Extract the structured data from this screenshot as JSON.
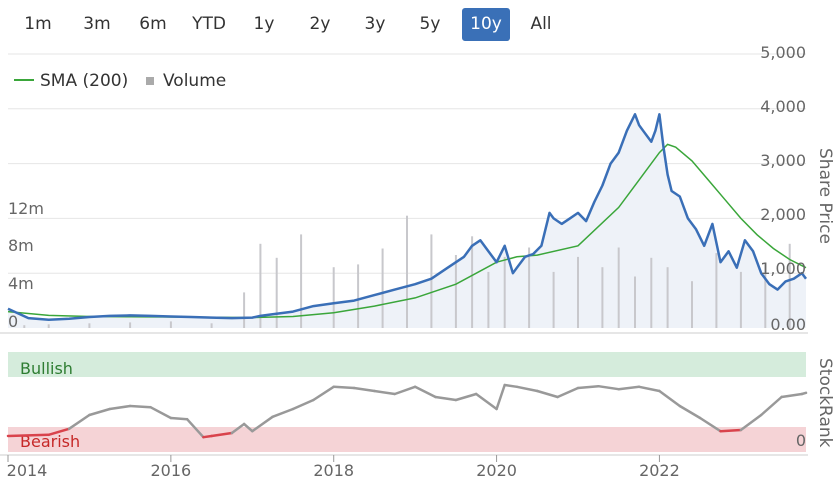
{
  "range_selector": {
    "buttons": [
      "1m",
      "3m",
      "6m",
      "YTD",
      "1y",
      "2y",
      "3y",
      "5y",
      "10y",
      "All"
    ],
    "active": "10y"
  },
  "colors": {
    "price": "#3a6fb7",
    "sma": "#3aa63a",
    "volume": "#c8c8cc",
    "rank_line": "#999999",
    "rank_bearish_line": "#d9434c",
    "bullish_band": "#d5ecdc",
    "bearish_band": "#f5d3d6",
    "active_button": "#3a70b7"
  },
  "chart_data": [
    {
      "type": "line",
      "legend": [
        {
          "name": "SMA (200)",
          "marker": "line"
        },
        {
          "name": "Volume",
          "marker": "square"
        }
      ],
      "ylabel": "Share Price",
      "price_ticks": [
        "5,000",
        "4,000",
        "3,000",
        "2,000",
        "1,000",
        "0.00"
      ],
      "price_ylim": [
        0,
        5000
      ],
      "volume_ticks": [
        "12m",
        "8m",
        "4m",
        "0"
      ],
      "volume_ylim": [
        0,
        14000000
      ],
      "x_ticks": [
        "2014",
        "2016",
        "2018",
        "2020",
        "2022"
      ],
      "xlim": [
        2014.0,
        2023.8
      ],
      "series": [
        {
          "name": "Price",
          "x": [
            2014.0,
            2014.25,
            2014.5,
            2014.75,
            2015.0,
            2015.25,
            2015.5,
            2015.75,
            2016.0,
            2016.25,
            2016.5,
            2016.75,
            2017.0,
            2017.1,
            2017.25,
            2017.5,
            2017.75,
            2018.0,
            2018.25,
            2018.5,
            2018.75,
            2019.0,
            2019.2,
            2019.4,
            2019.6,
            2019.7,
            2019.8,
            2019.9,
            2020.0,
            2020.1,
            2020.2,
            2020.25,
            2020.35,
            2020.45,
            2020.55,
            2020.65,
            2020.7,
            2020.8,
            2020.9,
            2021.0,
            2021.1,
            2021.2,
            2021.3,
            2021.4,
            2021.5,
            2021.6,
            2021.7,
            2021.75,
            2021.8,
            2021.9,
            2021.95,
            2022.0,
            2022.05,
            2022.1,
            2022.15,
            2022.25,
            2022.35,
            2022.45,
            2022.55,
            2022.65,
            2022.75,
            2022.85,
            2022.95,
            2023.05,
            2023.15,
            2023.25,
            2023.35,
            2023.45,
            2023.55,
            2023.65,
            2023.75,
            2023.8
          ],
          "y": [
            350,
            180,
            150,
            170,
            200,
            220,
            230,
            220,
            210,
            200,
            190,
            180,
            190,
            220,
            250,
            300,
            400,
            450,
            500,
            600,
            700,
            800,
            900,
            1100,
            1300,
            1500,
            1600,
            1400,
            1200,
            1500,
            1000,
            1100,
            1300,
            1350,
            1500,
            2100,
            2000,
            1900,
            2000,
            2100,
            1950,
            2300,
            2600,
            3000,
            3200,
            3600,
            3900,
            3700,
            3600,
            3400,
            3600,
            3900,
            3300,
            2800,
            2500,
            2400,
            2000,
            1800,
            1500,
            1900,
            1200,
            1400,
            1100,
            1600,
            1400,
            1000,
            800,
            700,
            850,
            900,
            1000,
            900
          ]
        },
        {
          "name": "SMA (200)",
          "x": [
            2014.0,
            2014.5,
            2015.0,
            2015.5,
            2016.0,
            2016.5,
            2017.0,
            2017.5,
            2018.0,
            2018.5,
            2019.0,
            2019.5,
            2020.0,
            2020.25,
            2020.5,
            2021.0,
            2021.5,
            2021.8,
            2022.0,
            2022.1,
            2022.2,
            2022.4,
            2022.6,
            2022.8,
            2023.0,
            2023.2,
            2023.4,
            2023.6,
            2023.8
          ],
          "y": [
            300,
            230,
            210,
            205,
            200,
            195,
            190,
            210,
            280,
            400,
            550,
            800,
            1200,
            1300,
            1330,
            1500,
            2200,
            2800,
            3200,
            3350,
            3300,
            3050,
            2700,
            2350,
            2000,
            1700,
            1450,
            1250,
            1100
          ]
        },
        {
          "name": "Volume",
          "x": [
            2014.2,
            2014.5,
            2015.0,
            2015.5,
            2016.0,
            2016.5,
            2016.9,
            2017.1,
            2017.3,
            2017.6,
            2018.0,
            2018.3,
            2018.6,
            2018.9,
            2019.2,
            2019.5,
            2019.7,
            2019.9,
            2020.1,
            2020.4,
            2020.7,
            2021.0,
            2021.3,
            2021.5,
            2021.7,
            2021.9,
            2022.1,
            2022.4,
            2022.7,
            2023.0,
            2023.3,
            2023.6
          ],
          "y": [
            300000,
            400000,
            500000,
            600000,
            700000,
            500000,
            3800000,
            9000000,
            7500000,
            10000000,
            6500000,
            6800000,
            8500000,
            12000000,
            10000000,
            7800000,
            9800000,
            6000000,
            7600000,
            8600000,
            6000000,
            7600000,
            6500000,
            8600000,
            5500000,
            7500000,
            6500000,
            5000000,
            8000000,
            6000000,
            7000000,
            9000000
          ]
        }
      ]
    },
    {
      "type": "line",
      "ylabel": "StockRank",
      "zones": [
        "Bullish",
        "Bearish"
      ],
      "y_ticks": [
        "0"
      ],
      "ylim": [
        0,
        100
      ],
      "xlim": [
        2014.0,
        2023.8
      ],
      "series": [
        {
          "name": "StockRank",
          "x": [
            2014.0,
            2014.5,
            2014.75,
            2015.0,
            2015.25,
            2015.5,
            2015.75,
            2016.0,
            2016.2,
            2016.4,
            2016.5,
            2016.75,
            2016.9,
            2017.0,
            2017.25,
            2017.5,
            2017.75,
            2018.0,
            2018.25,
            2018.5,
            2018.75,
            2019.0,
            2019.25,
            2019.5,
            2019.75,
            2020.0,
            2020.1,
            2020.25,
            2020.5,
            2020.75,
            2021.0,
            2021.25,
            2021.5,
            2021.75,
            2022.0,
            2022.25,
            2022.5,
            2022.75,
            2023.0,
            2023.25,
            2023.5,
            2023.75,
            2023.8
          ],
          "y": [
            10,
            12,
            22,
            45,
            55,
            60,
            58,
            40,
            38,
            8,
            10,
            15,
            30,
            18,
            42,
            55,
            70,
            92,
            90,
            85,
            80,
            92,
            75,
            70,
            80,
            55,
            95,
            92,
            85,
            75,
            90,
            93,
            88,
            92,
            85,
            60,
            40,
            18,
            20,
            45,
            75,
            80,
            82
          ]
        }
      ]
    }
  ]
}
